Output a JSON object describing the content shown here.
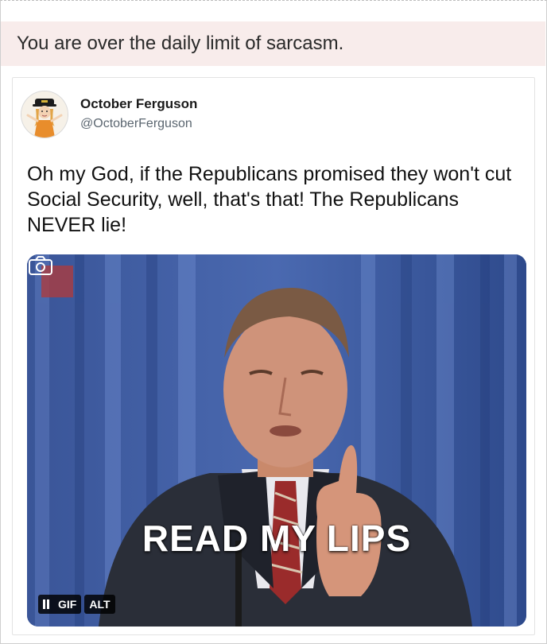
{
  "banner": {
    "text": "You are over the daily limit of sarcasm."
  },
  "tweet": {
    "author_name": "October Ferguson",
    "author_handle": "@OctoberFerguson",
    "text": "Oh my God, if the Republicans promised they won't cut Social Security, well, that's that! The Republicans NEVER lie!",
    "media": {
      "caption": "READ MY LIPS",
      "gif_label": "GIF",
      "alt_label": "ALT",
      "camera_icon": "camera-icon",
      "pause_icon": "pause-icon"
    }
  },
  "colors": {
    "banner_bg": "#f8eceb",
    "curtain_blue": "#3d5ba0",
    "handle_gray": "#5b6670"
  }
}
